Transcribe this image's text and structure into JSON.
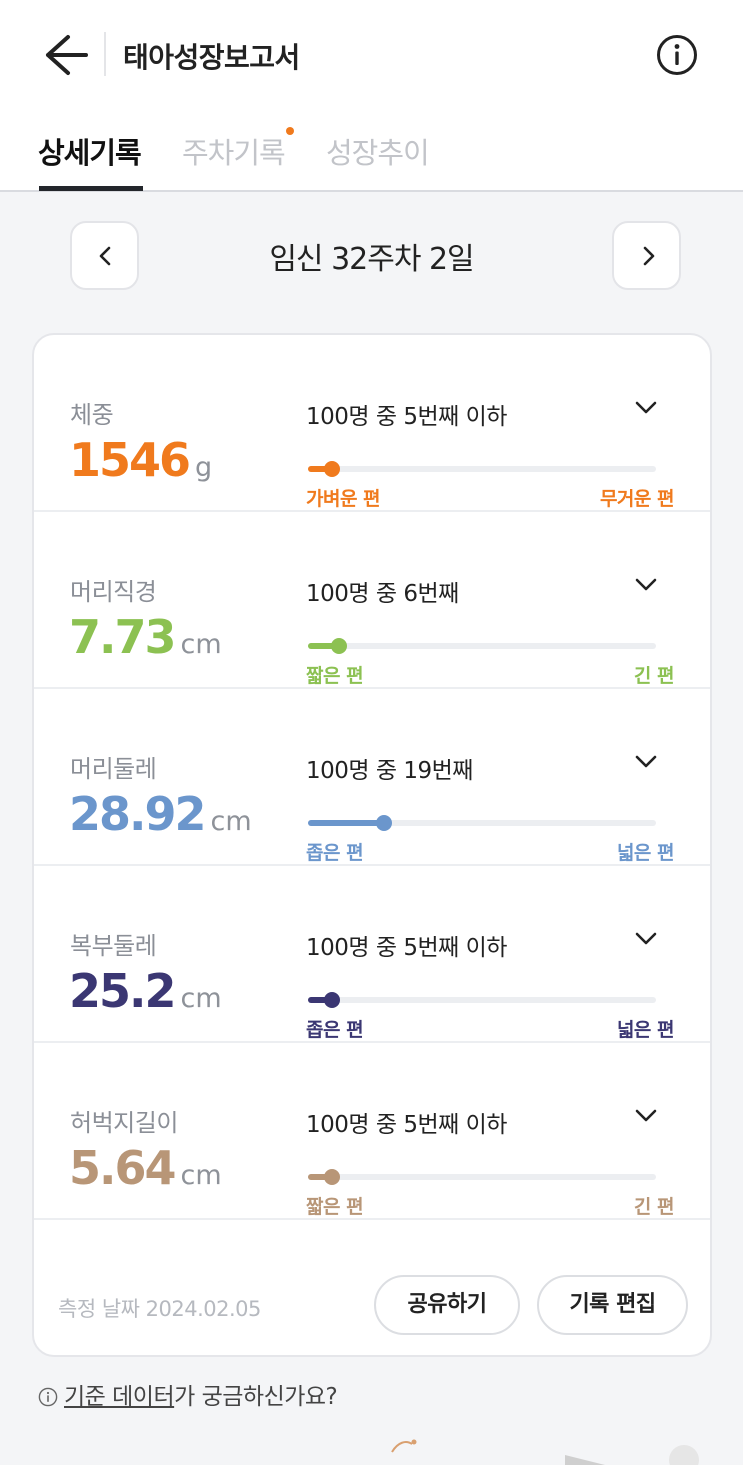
{
  "header": {
    "title": "태아성장보고서",
    "back_icon": "arrow-left-icon",
    "info_icon": "info-circle-icon"
  },
  "tabs": [
    {
      "label": "상세기록",
      "active": true
    },
    {
      "label": "주차기록",
      "active": false,
      "has_dot": true
    },
    {
      "label": "성장추이",
      "active": false
    }
  ],
  "week_nav": {
    "label": "임신 32주차 2일",
    "prev_icon": "chevron-left-icon",
    "next_icon": "chevron-right-icon"
  },
  "metrics": [
    {
      "name": "체중",
      "value": "1546",
      "unit": "g",
      "rank": "100명 중 5번째 이하",
      "left_label": "가벼운 편",
      "right_label": "무거운 편",
      "color": "#f07a1d",
      "percentile": 0.04
    },
    {
      "name": "머리직경",
      "value": "7.73",
      "unit": "cm",
      "rank": "100명 중 6번째",
      "left_label": "짧은 편",
      "right_label": "긴 편",
      "color": "#8cc152",
      "percentile": 0.06
    },
    {
      "name": "머리둘레",
      "value": "28.92",
      "unit": "cm",
      "rank": "100명 중 19번째",
      "left_label": "좁은 편",
      "right_label": "넓은 편",
      "color": "#6b96cc",
      "percentile": 0.19
    },
    {
      "name": "복부둘레",
      "value": "25.2",
      "unit": "cm",
      "rank": "100명 중 5번째 이하",
      "left_label": "좁은 편",
      "right_label": "넓은 편",
      "color": "#3b3773",
      "percentile": 0.04
    },
    {
      "name": "허벅지길이",
      "value": "5.64",
      "unit": "cm",
      "rank": "100명 중 5번째 이하",
      "left_label": "짧은 편",
      "right_label": "긴 편",
      "color": "#b89677",
      "percentile": 0.04
    }
  ],
  "footer": {
    "date": "측정 날짜 2024.02.05",
    "share_label": "공유하기",
    "edit_label": "기록 편집"
  },
  "help": {
    "link_text": "기준 데이터",
    "suffix": "가 궁금하신가요?"
  }
}
